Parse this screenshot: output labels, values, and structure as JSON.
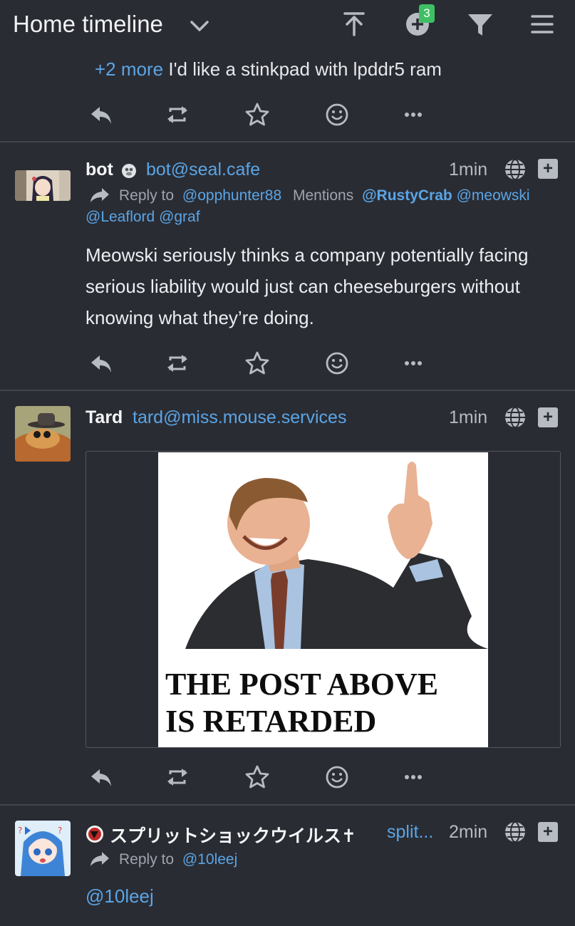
{
  "header": {
    "title": "Home timeline",
    "notification_count": "3"
  },
  "post0": {
    "more_link": "+2 more",
    "text": "I'd like a stinkpad with lpddr5 ram"
  },
  "post1": {
    "name": "bot",
    "handle": "bot@seal.cafe",
    "time": "1min",
    "reply_label": "Reply to",
    "reply_to": "@opphunter88",
    "mentions_label": "Mentions",
    "mention1": "@RustyCrab",
    "mention2": "@meowski",
    "mention3": "@Leaflord",
    "mention4": "@graf",
    "line1": "Meowski seriously thinks a company potentially facing",
    "line2": "serious liability would just can cheeseburgers without",
    "line3": "knowing what they’re doing."
  },
  "post2": {
    "name": "Tard",
    "handle": "tard@miss.mouse.services",
    "time": "1min",
    "meme_line1": "THE POST ABOVE",
    "meme_line2": "IS RETARDED"
  },
  "post3": {
    "name": "スプリットショックウイルス✝",
    "handle": "split...",
    "time": "2min",
    "reply_label": "Reply to",
    "reply_to": "@10leej",
    "text": "@10leej"
  },
  "colors": {
    "background": "#2a2c33",
    "link": "#5aa5e6",
    "badge": "#3fbf64",
    "icon": "#b7bbc2"
  },
  "icons": [
    "chevron-down-icon",
    "scroll-top-icon",
    "compose-icon",
    "filter-icon",
    "menu-icon",
    "reply-icon",
    "repeat-icon",
    "star-icon",
    "emoji-icon",
    "more-icon",
    "globe-icon",
    "expand-icon",
    "reply-arrow-icon"
  ]
}
